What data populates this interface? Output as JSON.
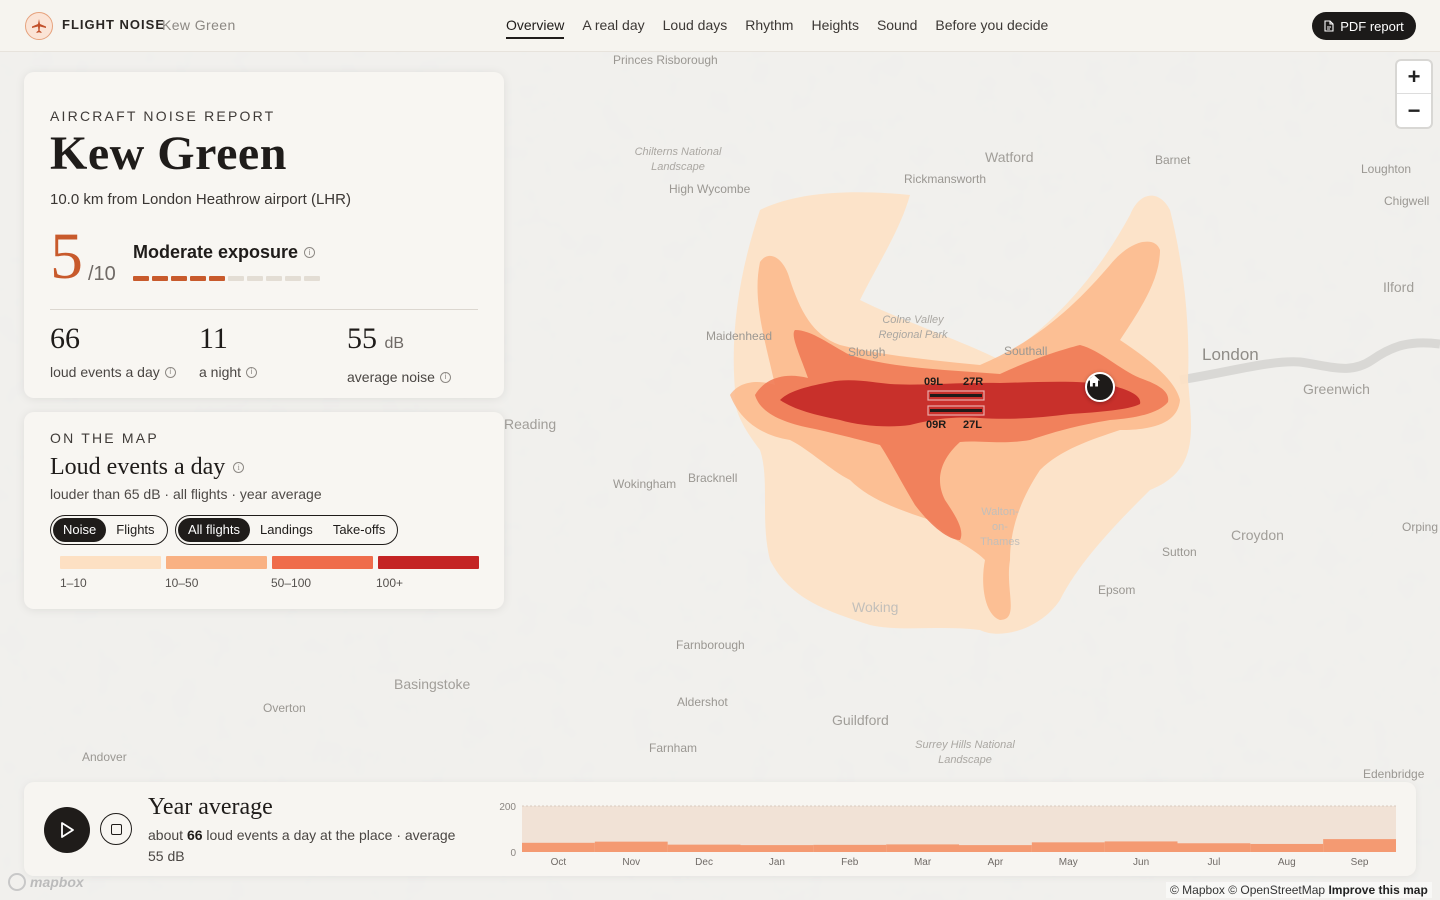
{
  "header": {
    "brand": "FLIGHT NOISE",
    "place": "Kew Green",
    "nav": [
      "Overview",
      "A real day",
      "Loud days",
      "Rhythm",
      "Heights",
      "Sound",
      "Before you decide"
    ],
    "active_nav": "Overview",
    "pdf_label": "PDF report"
  },
  "report": {
    "eyebrow": "AIRCRAFT NOISE REPORT",
    "title": "Kew Green",
    "distance": "10.0 km from London Heathrow airport (LHR)",
    "score": "5",
    "score_of": "/10",
    "score_fraction": 0.5,
    "exposure_label": "Moderate exposure",
    "stats": [
      {
        "value": "66",
        "unit": "",
        "label": "loud events a day"
      },
      {
        "value": "11",
        "unit": "",
        "label": "a night"
      },
      {
        "value": "55",
        "unit": "dB",
        "label": "average noise"
      }
    ]
  },
  "legend": {
    "eyebrow": "ON THE MAP",
    "title": "Loud events a day",
    "subtitle": "louder than 65 dB · all flights · year average",
    "mode_toggle": [
      "Noise",
      "Flights"
    ],
    "mode_selected": "Noise",
    "flight_toggle": [
      "All flights",
      "Landings",
      "Take-offs"
    ],
    "flight_selected": "All flights",
    "bins": [
      {
        "label": "1–10",
        "color": "#fde0c3"
      },
      {
        "label": "10–50",
        "color": "#f9b183"
      },
      {
        "label": "50–100",
        "color": "#ef6c4b"
      },
      {
        "label": "100+",
        "color": "#c42424"
      }
    ]
  },
  "map": {
    "places": [
      {
        "name": "Princes Risborough"
      },
      {
        "name": "Chilterns National Landscape"
      },
      {
        "name": "High Wycombe"
      },
      {
        "name": "Watford"
      },
      {
        "name": "Rickmansworth"
      },
      {
        "name": "Barnet"
      },
      {
        "name": "Loughton"
      },
      {
        "name": "Chigwell"
      },
      {
        "name": "Ilford"
      },
      {
        "name": "London"
      },
      {
        "name": "Greenwich"
      },
      {
        "name": "Colne Valley Regional Park"
      },
      {
        "name": "Maidenhead"
      },
      {
        "name": "Slough"
      },
      {
        "name": "Southall"
      },
      {
        "name": "Reading"
      },
      {
        "name": "Wokingham"
      },
      {
        "name": "Bracknell"
      },
      {
        "name": "Croydon"
      },
      {
        "name": "Orping"
      },
      {
        "name": "Sutton"
      },
      {
        "name": "Epsom"
      },
      {
        "name": "Woking"
      },
      {
        "name": "Farnborough"
      },
      {
        "name": "Basingstoke"
      },
      {
        "name": "Overton"
      },
      {
        "name": "Aldershot"
      },
      {
        "name": "Guildford"
      },
      {
        "name": "Farnham"
      },
      {
        "name": "Surrey Hills National Landscape"
      },
      {
        "name": "Andover"
      },
      {
        "name": "Edenbridge"
      },
      {
        "name": "Walton-on-Thames"
      }
    ],
    "runways": {
      "north": [
        "09L",
        "27R"
      ],
      "south": [
        "09R",
        "27L"
      ]
    },
    "zoom_in": "+",
    "zoom_out": "−"
  },
  "timeline": {
    "title": "Year average",
    "desc_prefix": "about",
    "desc_count": "66",
    "desc_suffix": "loud events a day at the place · average",
    "desc_noise": "55 dB"
  },
  "chart_data": {
    "type": "bar",
    "categories": [
      "Oct",
      "Nov",
      "Dec",
      "Jan",
      "Feb",
      "Mar",
      "Apr",
      "May",
      "Jun",
      "Jul",
      "Aug",
      "Sep"
    ],
    "values": [
      40,
      45,
      32,
      30,
      31,
      33,
      30,
      42,
      46,
      38,
      35,
      56
    ],
    "ylim": [
      0,
      200
    ],
    "yticks": [
      0,
      200
    ],
    "bar_color": "#f49a72",
    "bg_color": "#f1e2d6"
  },
  "footer": {
    "mapbox": "mapbox",
    "attribution": "© Mapbox © OpenStreetMap",
    "improve": "Improve this map"
  }
}
